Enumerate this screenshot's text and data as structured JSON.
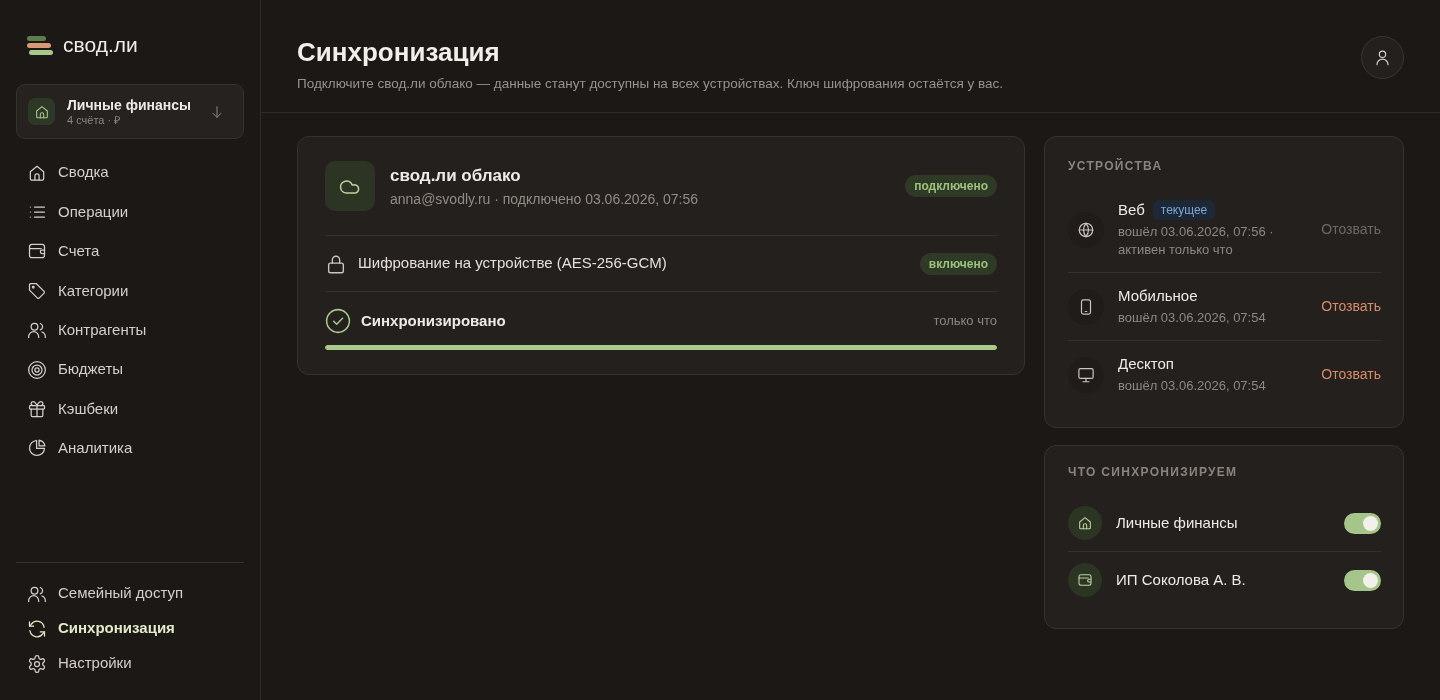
{
  "sidebar": {
    "logo": "свод.ли",
    "workspace": {
      "name": "Личные финансы",
      "meta": "4 счёта · ₽"
    },
    "nav": [
      {
        "kind": "home",
        "label": "Сводка",
        "selected": false
      },
      {
        "kind": "list",
        "label": "Операции",
        "selected": false
      },
      {
        "kind": "wallet",
        "label": "Счета",
        "selected": false
      },
      {
        "kind": "tag",
        "label": "Категории",
        "selected": false
      },
      {
        "kind": "users",
        "label": "Контрагенты",
        "selected": false
      },
      {
        "kind": "target",
        "label": "Бюджеты",
        "selected": false
      },
      {
        "kind": "gift",
        "label": "Кэшбеки",
        "selected": false
      },
      {
        "kind": "pie",
        "label": "Аналитика",
        "selected": false
      }
    ],
    "footer_nav": [
      {
        "kind": "users",
        "label": "Семейный доступ",
        "selected": false
      },
      {
        "kind": "sync",
        "label": "Синхронизация",
        "selected": true
      },
      {
        "kind": "gear",
        "label": "Настройки",
        "selected": false
      }
    ]
  },
  "header": {
    "title": "Синхронизация",
    "subtitle": "Подключите свод.ли облако — данные станут доступны на всех устройствах. Ключ шифрования остаётся у вас."
  },
  "cloud": {
    "title": "свод.ли облако",
    "details": "anna@svodly.ru · подключено 03.06.2026, 07:56",
    "status": "подключено",
    "encryption": {
      "label": "Шифрование на устройстве (AES-256-GCM)",
      "status": "включено"
    },
    "sync": {
      "label": "Синхронизировано",
      "time": "только что",
      "level": 1
    }
  },
  "devices": {
    "heading": "УСТРОЙСТВА",
    "items": [
      {
        "kind": "web",
        "name": "Веб",
        "badge": "текущее",
        "details": "вошёл 03.06.2026, 07:56 · активен только что",
        "action": "Отозвать",
        "disabled": true
      },
      {
        "kind": "mobile",
        "name": "Мобильное",
        "details": "вошёл 03.06.2026, 07:54",
        "action": "Отозвать",
        "disabled": false
      },
      {
        "kind": "desktop",
        "name": "Десктоп",
        "details": "вошёл 03.06.2026, 07:54",
        "action": "Отозвать",
        "disabled": false
      }
    ]
  },
  "sync_scope": {
    "heading": "ЧТО СИНХРОНИЗИРУЕМ",
    "items": [
      {
        "kind": "home",
        "name": "Личные финансы",
        "on": true
      },
      {
        "kind": "wallet",
        "name": "ИП Соколова А. В.",
        "on": true
      }
    ]
  }
}
